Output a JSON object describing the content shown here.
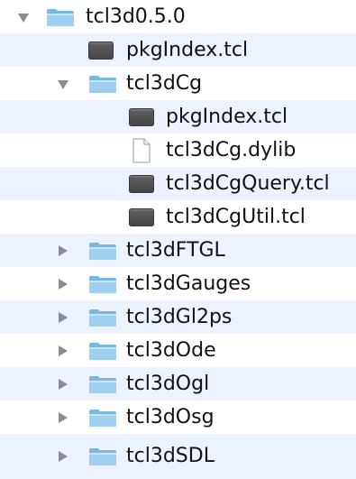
{
  "colors": {
    "alternate_row": "#edf3fe",
    "disclosure_triangle": "#8c8c8c",
    "folder_body": "#9fd0ef",
    "script_icon": "#4d4d4d"
  },
  "items": [
    {
      "label": "tcl3d0.5.0",
      "icon": "folder-icon",
      "state": "expanded"
    },
    {
      "label": "pkgIndex.tcl",
      "icon": "script-file-icon"
    },
    {
      "label": "tcl3dCg",
      "icon": "folder-icon",
      "state": "expanded"
    },
    {
      "label": "pkgIndex.tcl",
      "icon": "script-file-icon"
    },
    {
      "label": "tcl3dCg.dylib",
      "icon": "document-icon"
    },
    {
      "label": "tcl3dCgQuery.tcl",
      "icon": "script-file-icon"
    },
    {
      "label": "tcl3dCgUtil.tcl",
      "icon": "script-file-icon"
    },
    {
      "label": "tcl3dFTGL",
      "icon": "folder-icon",
      "state": "collapsed"
    },
    {
      "label": "tcl3dGauges",
      "icon": "folder-icon",
      "state": "collapsed"
    },
    {
      "label": "tcl3dGl2ps",
      "icon": "folder-icon",
      "state": "collapsed"
    },
    {
      "label": "tcl3dOde",
      "icon": "folder-icon",
      "state": "collapsed"
    },
    {
      "label": "tcl3dOgl",
      "icon": "folder-icon",
      "state": "collapsed"
    },
    {
      "label": "tcl3dOsg",
      "icon": "folder-icon",
      "state": "collapsed"
    },
    {
      "label": "tcl3dSDL",
      "icon": "folder-icon",
      "state": "collapsed"
    }
  ]
}
